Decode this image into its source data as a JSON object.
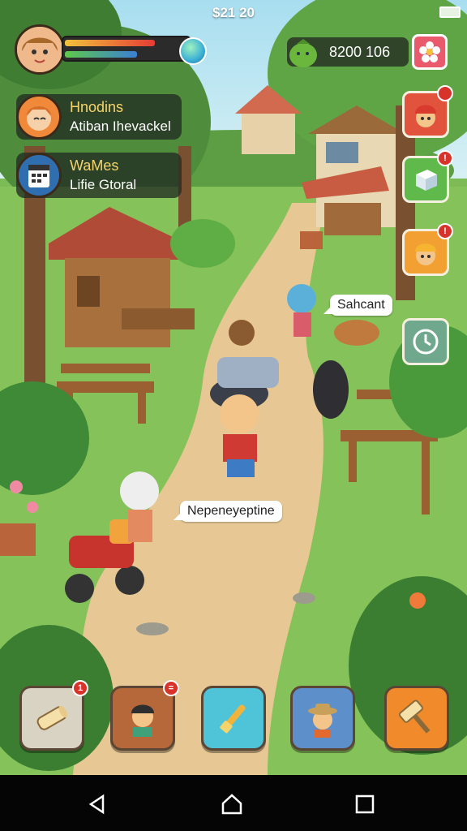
{
  "status_bar": {
    "time": "$21 20"
  },
  "player": {
    "avatar_icon": "girl-avatar-icon",
    "health_pct": 0.72,
    "energy_pct": 0.58
  },
  "currency": {
    "icon": "money-bag-icon",
    "amount": "8200 106"
  },
  "settings": {
    "icon": "flower-settings-icon"
  },
  "quests": [
    {
      "title": "Hnodins",
      "subtitle": "Atiban Ihevackel",
      "icon": "girl-avatar-icon"
    },
    {
      "title": "WaMes",
      "subtitle": "Lifie Gtoral",
      "icon": "calendar-icon"
    }
  ],
  "side_buttons": [
    {
      "name": "side-boy-helmet",
      "icon": "boy-helmet-icon",
      "color": "#e1533d"
    },
    {
      "name": "side-package",
      "icon": "package-icon",
      "color": "#5fba4b"
    },
    {
      "name": "side-builder",
      "icon": "builder-icon",
      "color": "#f1a031"
    },
    {
      "name": "side-clock",
      "icon": "clock-icon",
      "color": "#6fa88d"
    }
  ],
  "bubbles": {
    "bubble_1": "Sahcant",
    "bubble_2": "Nepeneyeptine"
  },
  "bottom_buttons": [
    {
      "name": "bottom-wood",
      "icon": "wood-log-icon",
      "color": "#d9d3c3",
      "badge": "1"
    },
    {
      "name": "bottom-villager",
      "icon": "villager-icon",
      "color": "#b7683a",
      "badge": "="
    },
    {
      "name": "bottom-tools",
      "icon": "paint-tools-icon",
      "color": "#4fc4d8",
      "badge": ""
    },
    {
      "name": "bottom-farmer",
      "icon": "farmer-icon",
      "color": "#5d8fcb",
      "badge": ""
    },
    {
      "name": "bottom-hammer",
      "icon": "hammer-icon",
      "color": "#f08a2a",
      "badge": ""
    }
  ],
  "nav": {
    "back": "back-icon",
    "home": "home-icon",
    "recents": "recents-icon"
  }
}
